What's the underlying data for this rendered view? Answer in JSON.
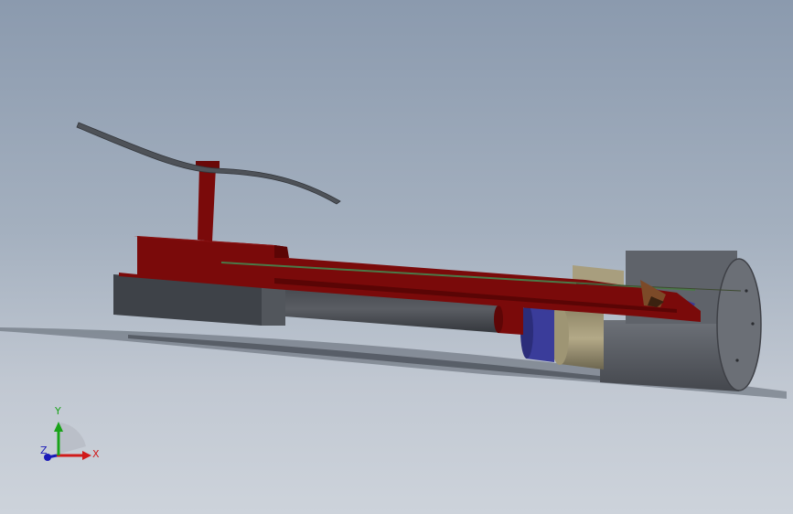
{
  "view": {
    "background_top": "#8b9aae",
    "background_bottom": "#cdd3db"
  },
  "model": {
    "frame_color": "#7a0a0a",
    "base_color": "#3f4349",
    "motor_color": "#55585e",
    "rail_color": "#4a7a48",
    "brass_color": "#b8ab8a",
    "blue_color": "#3a3c9a"
  },
  "triad": {
    "x_label": "X",
    "y_label": "Y",
    "z_label": "Z",
    "x_color": "#d01a1a",
    "y_color": "#19a319",
    "z_color": "#1a1ab8"
  }
}
